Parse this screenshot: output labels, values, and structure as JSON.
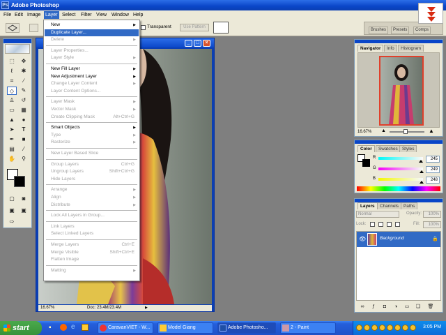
{
  "app": {
    "title": "Adobe Photoshop"
  },
  "menubar": [
    "File",
    "Edit",
    "Image",
    "Layer",
    "Select",
    "Filter",
    "View",
    "Window",
    "Help"
  ],
  "options_bar": {
    "transparent_label": "Transparent",
    "use_pattern_label": "Use Pattern"
  },
  "palette_well": [
    "Brushes",
    "Presets",
    "Comps"
  ],
  "layer_menu": {
    "items": [
      {
        "label": "New",
        "submenu": true,
        "enabled": true
      },
      {
        "label": "Duplicate Layer...",
        "enabled": true,
        "highlighted": true
      },
      {
        "label": "Delete",
        "submenu": true,
        "enabled": false
      },
      {
        "sep": true
      },
      {
        "label": "Layer Properties...",
        "enabled": false
      },
      {
        "label": "Layer Style",
        "submenu": true,
        "enabled": false
      },
      {
        "sep": true
      },
      {
        "label": "New Fill Layer",
        "submenu": true,
        "enabled": true
      },
      {
        "label": "New Adjustment Layer",
        "submenu": true,
        "enabled": true
      },
      {
        "label": "Change Layer Content",
        "submenu": true,
        "enabled": false
      },
      {
        "label": "Layer Content Options...",
        "enabled": false
      },
      {
        "sep": true
      },
      {
        "label": "Layer Mask",
        "submenu": true,
        "enabled": false
      },
      {
        "label": "Vector Mask",
        "submenu": true,
        "enabled": false
      },
      {
        "label": "Create Clipping Mask",
        "shortcut": "Alt+Ctrl+G",
        "enabled": false
      },
      {
        "sep": true
      },
      {
        "label": "Smart Objects",
        "submenu": true,
        "enabled": true
      },
      {
        "label": "Type",
        "submenu": true,
        "enabled": false
      },
      {
        "label": "Rasterize",
        "submenu": true,
        "enabled": false
      },
      {
        "sep": true
      },
      {
        "label": "New Layer Based Slice",
        "enabled": false
      },
      {
        "sep": true
      },
      {
        "label": "Group Layers",
        "shortcut": "Ctrl+G",
        "enabled": false
      },
      {
        "label": "Ungroup Layers",
        "shortcut": "Shift+Ctrl+G",
        "enabled": false
      },
      {
        "label": "Hide Layers",
        "enabled": false
      },
      {
        "sep": true
      },
      {
        "label": "Arrange",
        "submenu": true,
        "enabled": false
      },
      {
        "label": "Align",
        "submenu": true,
        "enabled": false
      },
      {
        "label": "Distribute",
        "submenu": true,
        "enabled": false
      },
      {
        "sep": true
      },
      {
        "label": "Lock All Layers in Group...",
        "enabled": false
      },
      {
        "sep": true
      },
      {
        "label": "Link Layers",
        "enabled": false
      },
      {
        "label": "Select Linked Layers",
        "enabled": false
      },
      {
        "sep": true
      },
      {
        "label": "Merge Layers",
        "shortcut": "Ctrl+E",
        "enabled": false
      },
      {
        "label": "Merge Visible",
        "shortcut": "Shift+Ctrl+E",
        "enabled": false
      },
      {
        "label": "Flatten Image",
        "enabled": false
      },
      {
        "sep": true
      },
      {
        "label": "Matting",
        "submenu": true,
        "enabled": false
      }
    ]
  },
  "document": {
    "zoom": "16.67%",
    "doc_info": "Doc: 23.4M/23.4M"
  },
  "navigator": {
    "tabs": [
      "Navigator",
      "Info",
      "Histogram"
    ],
    "zoom": "16.67%"
  },
  "color_panel": {
    "tabs": [
      "Color",
      "Swatches",
      "Styles"
    ],
    "channels": [
      {
        "label": "R",
        "value": "245",
        "level": 0.96
      },
      {
        "label": "G",
        "value": "249",
        "level": 0.976
      },
      {
        "label": "B",
        "value": "248",
        "level": 0.973
      }
    ]
  },
  "layers_panel": {
    "tabs": [
      "Layers",
      "Channels",
      "Paths"
    ],
    "blend_mode": "Normal",
    "opacity_label": "Opacity:",
    "opacity": "100%",
    "lock_label": "Lock:",
    "fill_label": "Fill:",
    "fill": "100%",
    "layers": [
      {
        "name": "Background"
      }
    ]
  },
  "taskbar": {
    "start": "start",
    "tasks": [
      "CaravanVIET - W...",
      "Model Giang",
      "Adobe Photosho...",
      "2 - Paint"
    ],
    "clock": "3:05 PM"
  },
  "colors": {
    "accent": "#316ac5",
    "xp_title": "#0a46c8",
    "chrome": "#ece9d8"
  }
}
